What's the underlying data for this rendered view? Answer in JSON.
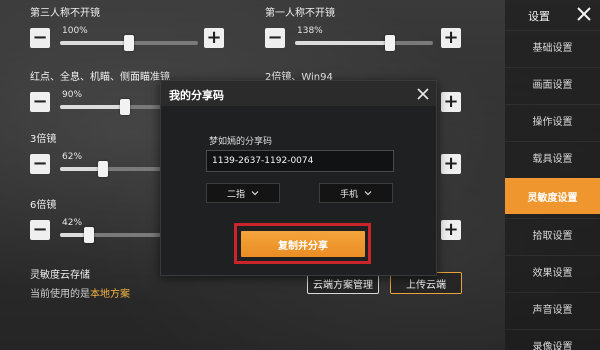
{
  "left_sliders": [
    {
      "title": "第三人称不开镜",
      "value": "100%",
      "level": 0.5
    },
    {
      "title": "红点、全息、机瞄、侧面瞄准镜",
      "value": "90%",
      "level": 0.47
    },
    {
      "title": "3倍镜",
      "value": "62%",
      "level": 0.31
    },
    {
      "title": "6倍镜",
      "value": "42%",
      "level": 0.21
    }
  ],
  "right_sliders": [
    {
      "title": "第一人称不开镜",
      "value": "138%",
      "level": 0.69
    },
    {
      "title": "2倍镜、Win94"
    }
  ],
  "cloud": {
    "title": "灵敏度云存储",
    "current_prefix": "当前使用的是",
    "current_plan": "本地方案",
    "manage_button": "云端方案管理",
    "upload_button": "上传云端"
  },
  "menu": {
    "title": "设置",
    "items": [
      "基础设置",
      "画面设置",
      "操作设置",
      "载具设置",
      "灵敏度设置",
      "拾取设置",
      "效果设置",
      "声音设置",
      "录像设置"
    ],
    "active": "灵敏度设置"
  },
  "modal": {
    "title": "我的分享码",
    "share_label": "梦如嫣的分享码",
    "share_code": "1139-2637-1192-0074",
    "finger_option": "二指",
    "device_option": "手机",
    "copy_button": "复制并分享"
  },
  "icons": {
    "minus": "−",
    "plus": "+"
  },
  "colors": {
    "accent": "#f0962f",
    "highlight": "#c9252b",
    "plan_highlight": "#f5b642"
  }
}
